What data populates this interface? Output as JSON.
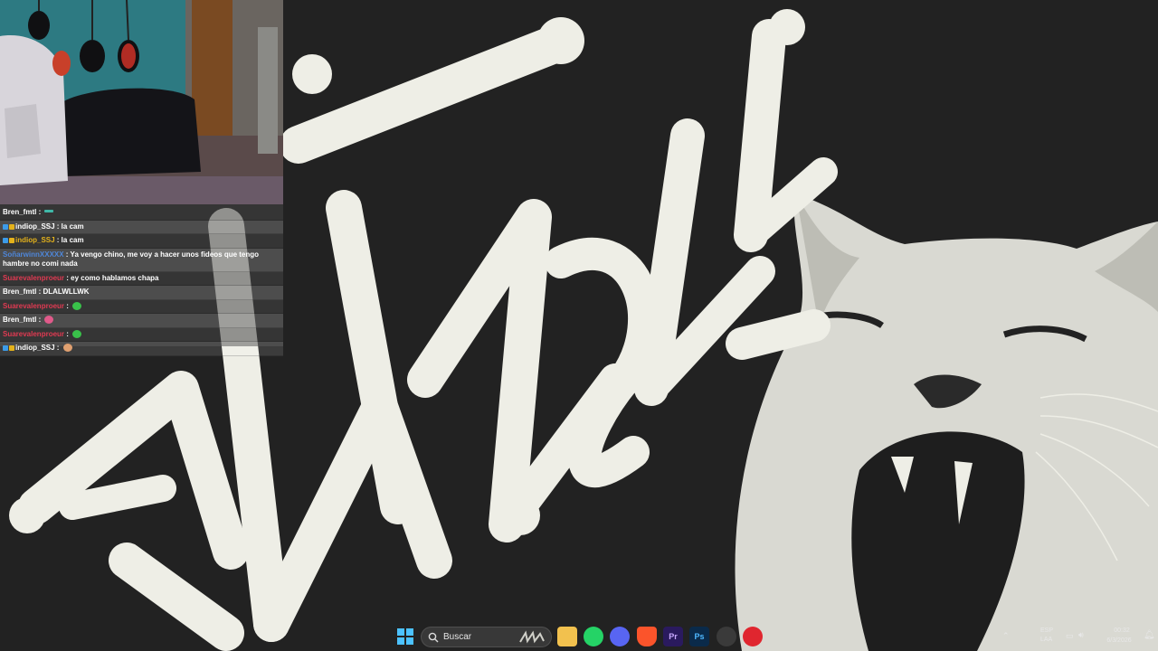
{
  "chat": {
    "messages": [
      {
        "user": "Bren_fmtl",
        "user_color": "#ffffff",
        "badges": false,
        "text": "",
        "emote": "teal-line-emote"
      },
      {
        "user": "indiop_SSJ",
        "user_color": "#ffffff",
        "badges": true,
        "text": "la cam",
        "emote": ""
      },
      {
        "user": "indiop_SSJ",
        "user_color": "#e4b21b",
        "badges": true,
        "text": "la cam",
        "emote": ""
      },
      {
        "user": "SoñarwinnXXXXX",
        "user_color": "#4e86d8",
        "badges": false,
        "text": "Ya vengo chino, me voy a hacer unos fideos que tengo hambre no comi nada",
        "emote": ""
      },
      {
        "user": "Suarevalenproeur",
        "user_color": "#e03a52",
        "badges": false,
        "text": "ey como hablamos chapa",
        "emote": ""
      },
      {
        "user": "Bren_fmtl",
        "user_color": "#ffffff",
        "badges": false,
        "text": "DLALWLLWK",
        "emote": ""
      },
      {
        "user": "Suarevalenproeur",
        "user_color": "#e03a52",
        "badges": false,
        "text": "",
        "emote": "green-blob-emote"
      },
      {
        "user": "Bren_fmtl",
        "user_color": "#ffffff",
        "badges": false,
        "text": "",
        "emote": "pink-emote"
      },
      {
        "user": "Suarevalenproeur",
        "user_color": "#e03a52",
        "badges": false,
        "text": "",
        "emote": "green-blob-emote"
      },
      {
        "user": "indiop_SSJ",
        "user_color": "#ffffff",
        "badges": true,
        "text": "",
        "emote": "hand-emote"
      }
    ]
  },
  "taskbar": {
    "search_placeholder": "Buscar",
    "apps": [
      {
        "name": "file-explorer-icon",
        "label": "",
        "color": "#f2c14e"
      },
      {
        "name": "whatsapp-icon",
        "label": "",
        "color": "#25d366"
      },
      {
        "name": "discord-icon",
        "label": "",
        "color": "#5865f2"
      },
      {
        "name": "brave-icon",
        "label": "",
        "color": "#fb542b"
      },
      {
        "name": "premiere-icon",
        "label": "Pr",
        "color": "#2a1a5e"
      },
      {
        "name": "photoshop-icon",
        "label": "Ps",
        "color": "#0a2a4a"
      },
      {
        "name": "obs-icon",
        "label": "",
        "color": "#3a3a3a"
      },
      {
        "name": "red-app-icon",
        "label": "",
        "color": "#e0262f"
      }
    ],
    "tray": {
      "language_top": "ESP",
      "language_bottom": "LAA",
      "time": "00:32",
      "date": "6/3/2026"
    }
  },
  "colors": {
    "wallpaper_bg": "#222222",
    "graffiti": "#eeeee6",
    "chat_bg": "rgba(70,70,70,0.55)"
  }
}
